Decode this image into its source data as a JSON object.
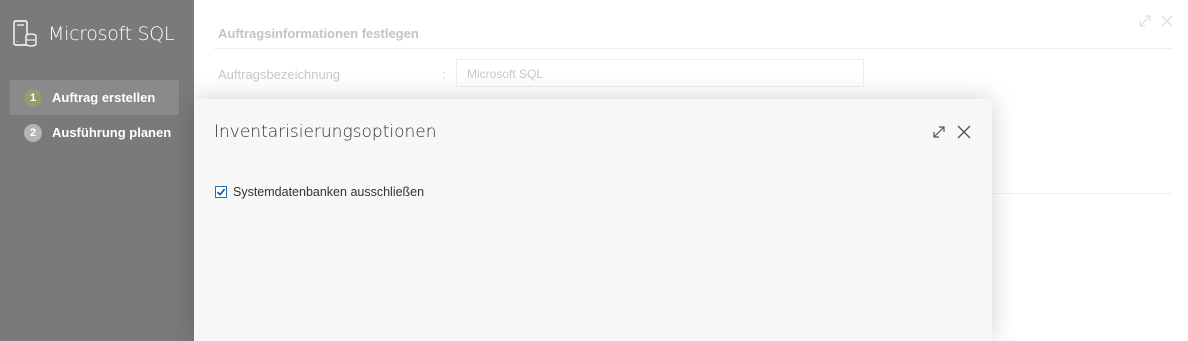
{
  "sidebar": {
    "title": "Microsoft SQL",
    "steps": [
      {
        "number": "1",
        "label": "Auftrag erstellen",
        "active": true
      },
      {
        "number": "2",
        "label": "Ausführung planen",
        "active": false
      }
    ]
  },
  "main": {
    "section_title": "Auftragsinformationen festlegen",
    "field_label": "Auftragsbezeichnung",
    "colon": ":",
    "field_value": "Microsoft SQL"
  },
  "dialog": {
    "title": "Inventarisierungsoptionen",
    "checkbox_label": "Systemdatenbanken ausschließen",
    "checkbox_checked": true
  },
  "icons": {
    "app": "sql-server-icon",
    "expand": "expand-icon",
    "close": "close-icon",
    "check": "checkmark-icon"
  },
  "colors": {
    "sidebar_bg": "#7a7a7a",
    "active_step_badge": "#8f9d6f",
    "checkbox_accent": "#1a6fb5"
  }
}
